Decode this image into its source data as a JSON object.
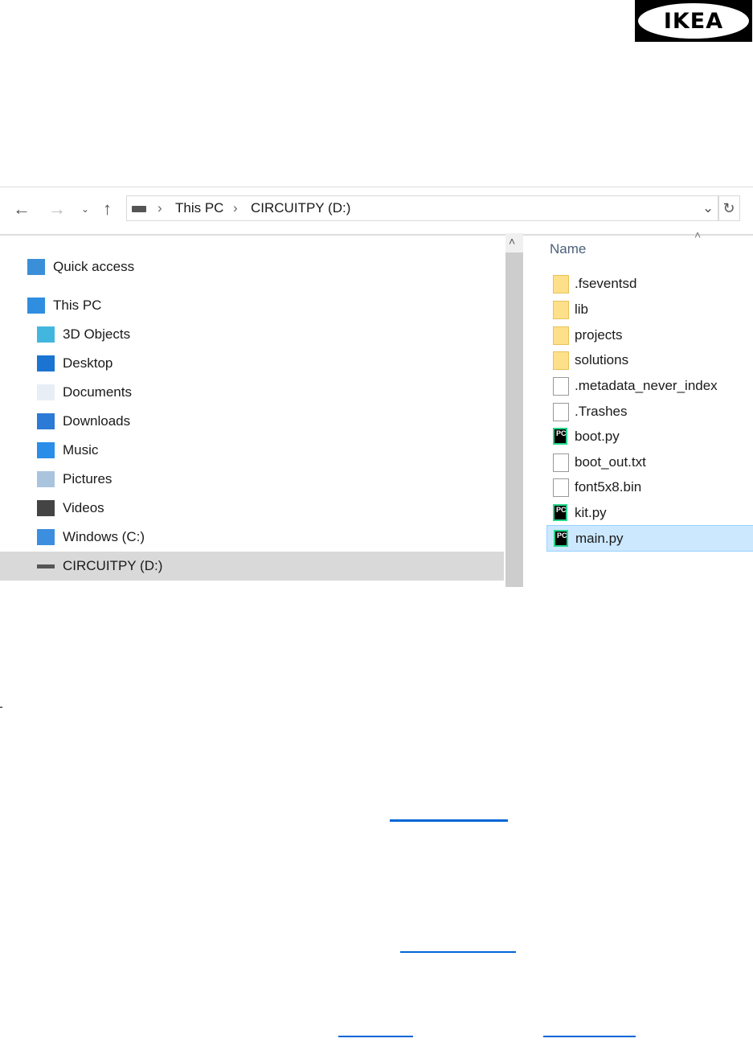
{
  "logo": "IKEA",
  "toolbar": {
    "breadcrumb": [
      "This PC",
      "CIRCUITPY (D:)"
    ]
  },
  "nav": {
    "items": [
      {
        "label": "Quick access",
        "icon": "star-icon"
      },
      {
        "label": "This PC",
        "icon": "computer-icon"
      },
      {
        "label": "3D Objects",
        "icon": "cube-icon"
      },
      {
        "label": "Desktop",
        "icon": "desktop-icon"
      },
      {
        "label": "Documents",
        "icon": "documents-icon"
      },
      {
        "label": "Downloads",
        "icon": "download-icon"
      },
      {
        "label": "Music",
        "icon": "music-icon"
      },
      {
        "label": "Pictures",
        "icon": "pictures-icon"
      },
      {
        "label": "Videos",
        "icon": "videos-icon"
      },
      {
        "label": "Windows (C:)",
        "icon": "drive-icon"
      },
      {
        "label": "CIRCUITPY (D:)",
        "icon": "usb-drive-icon",
        "selected": true
      }
    ]
  },
  "files": {
    "header": "Name",
    "items": [
      {
        "name": ".fseventsd",
        "type": "folder"
      },
      {
        "name": "lib",
        "type": "folder"
      },
      {
        "name": "projects",
        "type": "folder"
      },
      {
        "name": "solutions",
        "type": "folder"
      },
      {
        "name": ".metadata_never_index",
        "type": "file"
      },
      {
        "name": ".Trashes",
        "type": "file"
      },
      {
        "name": "boot.py",
        "type": "pycharm"
      },
      {
        "name": "boot_out.txt",
        "type": "text"
      },
      {
        "name": "font5x8.bin",
        "type": "file"
      },
      {
        "name": "kit.py",
        "type": "pycharm"
      },
      {
        "name": "main.py",
        "type": "pycharm",
        "selected": true
      }
    ]
  },
  "colors": {
    "link": "#0066d6",
    "selection": "#cce8ff"
  }
}
